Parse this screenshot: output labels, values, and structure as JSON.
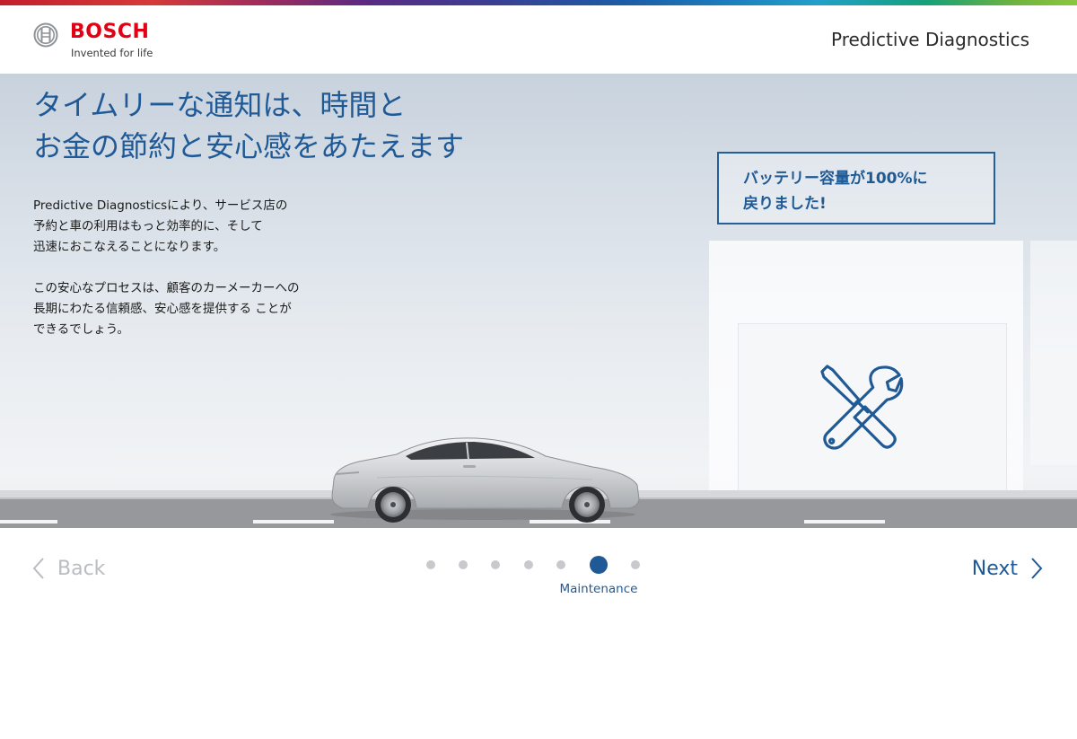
{
  "brand": {
    "name": "BOSCH",
    "tagline": "Invented for life",
    "brand_color": "#e20015"
  },
  "header": {
    "title": "Predictive Diagnostics"
  },
  "hero": {
    "headline_line1": "タイムリーな通知は、時間と",
    "headline_line2": "お金の節約と安心感をあたえます",
    "body_p1_line1": "Predictive Diagnosticsにより、サービス店の",
    "body_p1_line2": "予約と車の利用はもっと効率的に、そして",
    "body_p1_line3": "迅速におこなえることになります。",
    "body_p2_line1": "この安心なプロセスは、顧客のカーメーカーへの",
    "body_p2_line2": "長期にわたる信頼感、安心感を提供する ことが",
    "body_p2_line3": "できるでしょう。",
    "accent_color": "#1f5a96"
  },
  "callout": {
    "line1": "バッテリー容量が100%に",
    "line2": "戻りました!"
  },
  "icons": {
    "service": "wrench-screwdriver-icon",
    "back": "chevron-left-icon",
    "next": "chevron-right-icon"
  },
  "navigation": {
    "back_label": "Back",
    "next_label": "Next",
    "current_step_label": "Maintenance",
    "total_steps": 7,
    "current_step": 6
  }
}
